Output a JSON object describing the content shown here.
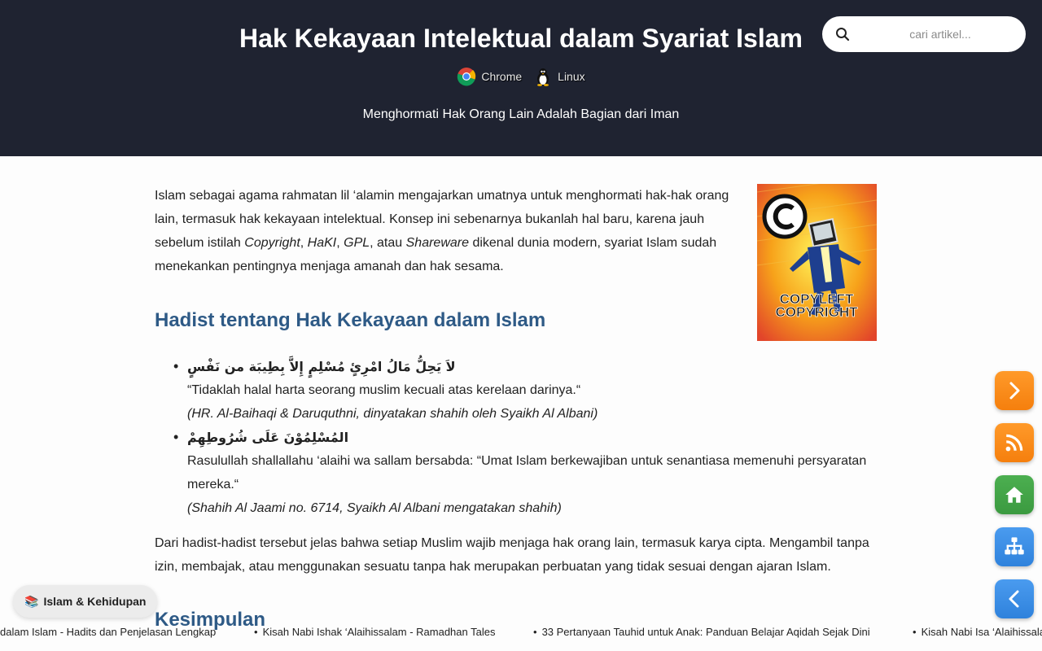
{
  "header": {
    "title": "Hak Kekayaan Intelektual dalam Syariat Islam",
    "platforms": [
      {
        "label": "Chrome",
        "icon": "chrome-icon"
      },
      {
        "label": "Linux",
        "icon": "linux-tux-icon"
      }
    ],
    "tagline": "Menghormati Hak Orang Lain Adalah Bagian dari Iman",
    "background": "#1f2331"
  },
  "search": {
    "placeholder": "cari artikel...",
    "icon": "search-icon"
  },
  "article": {
    "intro": {
      "p1": "Islam sebagai agama rahmatan lil ‘alamin mengajarkan umatnya untuk menghormati hak-hak orang lain, termasuk hak kekayaan intelektual. Konsep ini sebenarnya bukanlah hal baru, karena jauh sebelum istilah ",
      "t1": "Copyright",
      "c1": ", ",
      "t2": "HaKI",
      "c2": ", ",
      "t3": "GPL",
      "c3": ", atau ",
      "t4": "Shareware",
      "p2": " dikenal dunia modern, syariat Islam sudah menekankan pentingnya menjaga amanah dan hak sesama."
    },
    "image_caption_text": "COPYLEFT COPYRIGHT",
    "heading1": "Hadist tentang Hak Kekayaan dalam Islam",
    "hadiths": [
      {
        "arabic": "لاَ يَحِلُّ مَالُ امْرِئٍ مُسْلِمٍ إِلاَّ بِطِيبَة من نَفْسٍ",
        "translation": "“Tidaklah halal harta seorang muslim kecuali atas kerelaan darinya.“",
        "source": "(HR. Al-Baihaqi & Daruquthni, dinyatakan shahih oleh Syaikh Al Albani)"
      },
      {
        "arabic": "المُسْلِمُوْنَ عَلَى شُرُوطِهِمْ",
        "translation": "Rasulullah shallallahu ‘alaihi wa sallam bersabda: “Umat Islam berkewajiban untuk senantiasa memenuhi persyaratan mereka.“",
        "source": "(Shahih Al Jaami no. 6714, Syaikh Al Albani mengatakan shahih)"
      }
    ],
    "paragraph2": "Dari hadist-hadist tersebut jelas bahwa setiap Muslim wajib menjaga hak orang lain, termasuk karya cipta. Mengambil tanpa izin, membajak, atau menggunakan sesuatu tanpa hak merupakan perbuatan yang tidak sesuai dengan ajaran Islam.",
    "heading2": "Kesimpulan",
    "heading_color": "#2e5a86"
  },
  "side_buttons": [
    {
      "name": "next-button",
      "icon": "chevron-right-icon",
      "color": "#f57f0d"
    },
    {
      "name": "rss-button",
      "icon": "rss-icon",
      "color": "#f57f0d"
    },
    {
      "name": "home-button",
      "icon": "home-icon",
      "color": "#3b9a40"
    },
    {
      "name": "sitemap-button",
      "icon": "sitemap-icon",
      "color": "#2f82dc"
    },
    {
      "name": "prev-button",
      "icon": "chevron-left-icon",
      "color": "#2f82dc"
    }
  ],
  "category_chip": {
    "emoji": "📚",
    "label": "Islam & Kehidupan"
  },
  "ticker": [
    "dalam Islam - Hadits dan Penjelasan Lengkap",
    "Kisah Nabi Ishak ‘Alaihissalam - Ramadhan Tales",
    "33 Pertanyaan Tauhid untuk Anak: Panduan Belajar Aqidah Sejak Dini",
    "Kisah Nabi Isa ‘Alaihissalam"
  ]
}
